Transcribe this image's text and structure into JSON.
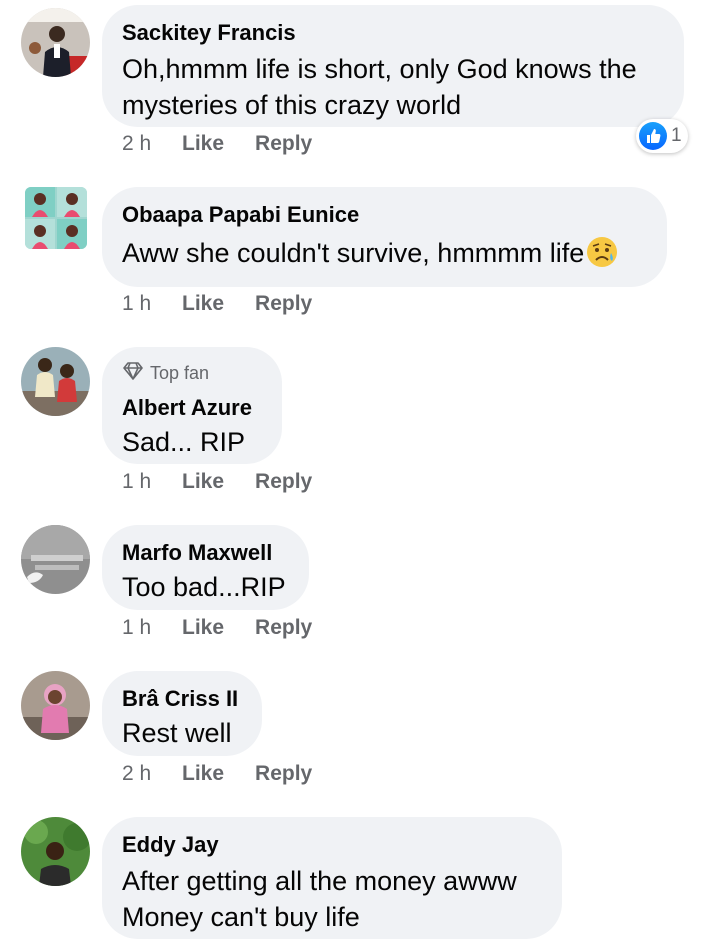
{
  "comments": [
    {
      "author": "Sackitey Francis",
      "text_lines": [
        "Oh,hmmm life is short, only God knows the",
        "mysteries of this crazy world"
      ],
      "time": "2 h",
      "like_label": "Like",
      "reply_label": "Reply",
      "reaction": {
        "icon": "thumbs-up-icon",
        "count": "1"
      },
      "avatar_icon": "profile-photo"
    },
    {
      "author": "Obaapa Papabi Eunice",
      "text": "Aww she couldn't survive, hmmmm life",
      "emoji": "sad-but-relieved-face-icon",
      "time": "1 h",
      "like_label": "Like",
      "reply_label": "Reply",
      "avatar_icon": "profile-photo"
    },
    {
      "badge": "Top fan",
      "badge_icon": "diamond-icon",
      "author": "Albert Azure",
      "text": "Sad... RIP",
      "time": "1 h",
      "like_label": "Like",
      "reply_label": "Reply",
      "avatar_icon": "profile-photo"
    },
    {
      "author": "Marfo Maxwell",
      "text": "Too bad...RIP",
      "time": "1 h",
      "like_label": "Like",
      "reply_label": "Reply",
      "avatar_icon": "profile-photo"
    },
    {
      "author": "Brâ Criss II",
      "text": "Rest well",
      "time": "2 h",
      "like_label": "Like",
      "reply_label": "Reply",
      "avatar_icon": "profile-photo"
    },
    {
      "author": "Eddy Jay",
      "text_lines": [
        "After getting all the money awww",
        "Money can't buy life"
      ],
      "avatar_icon": "profile-photo"
    }
  ],
  "colors": {
    "bubble": "#f0f2f5",
    "secondary_text": "#65676b",
    "like_blue": "#0866ff"
  }
}
